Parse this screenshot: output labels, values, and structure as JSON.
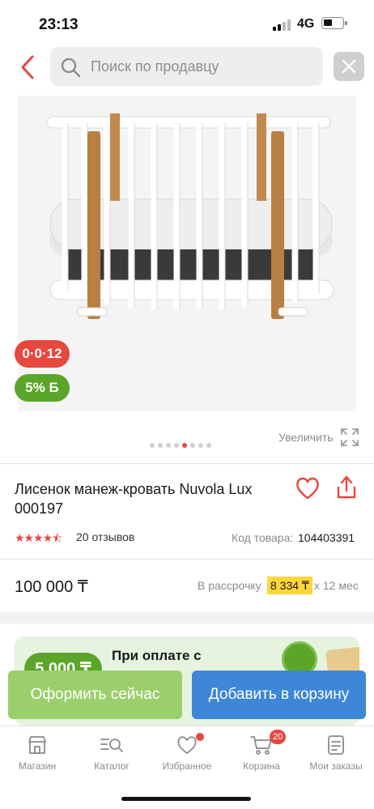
{
  "status_bar": {
    "time": "23:13",
    "network": "4G"
  },
  "search": {
    "placeholder": "Поиск по продавцу",
    "value": ""
  },
  "gallery": {
    "installment_badge": "0·0·12",
    "bonus_badge": "5% Б",
    "slide_count": 8,
    "active_slide": 5,
    "zoom_label": "Увеличить"
  },
  "product": {
    "title": "Лисенок манеж-кровать Nuvola Lux 000197",
    "rating": 4.5,
    "stars_text": "★★★★⯪",
    "reviews": "20 отзывов",
    "code_label": "Код товара:",
    "code_value": "104403391"
  },
  "price": {
    "value": "100 000 ₸",
    "installment_label": "В рассрочку",
    "installment_amount": "8 334 ₸",
    "installment_term": "х 12 мес"
  },
  "promo": {
    "pill": "5 000 ₸",
    "text": "При оплате с"
  },
  "actions": {
    "buy_now": "Оформить сейчас",
    "add_to_cart": "Добавить в корзину"
  },
  "tabs": {
    "shop": "Магазин",
    "catalog": "Каталог",
    "favorites": "Избранное",
    "cart": "Корзина",
    "cart_count": "20",
    "orders": "Мои заказы"
  },
  "colors": {
    "accent_red": "#e8473e",
    "bonus_green": "#5aa52a",
    "buy_green": "#9bcf6b",
    "cart_blue": "#3d86d8",
    "installment_yellow": "#ffd63a"
  }
}
